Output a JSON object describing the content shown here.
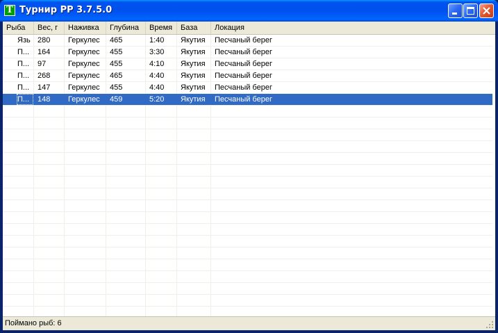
{
  "window": {
    "title": "Турнир РР 3.7.5.0",
    "icon_letter": "T",
    "icon_name": "app-icon",
    "accent_color": "#316ac5"
  },
  "table": {
    "columns": [
      "Рыба",
      "Вес, г",
      "Наживка",
      "Глубина",
      "Время",
      "База",
      "Локация"
    ],
    "rows": [
      [
        "Язь",
        "280",
        "Геркулес",
        "465",
        "1:40",
        "Якутия",
        "Песчаный берег"
      ],
      [
        "П...",
        "164",
        "Геркулес",
        "455",
        "3:30",
        "Якутия",
        "Песчаный берег"
      ],
      [
        "П...",
        "97",
        "Геркулес",
        "455",
        "4:10",
        "Якутия",
        "Песчаный берег"
      ],
      [
        "П...",
        "268",
        "Геркулес",
        "465",
        "4:40",
        "Якутия",
        "Песчаный берег"
      ],
      [
        "П...",
        "147",
        "Геркулес",
        "455",
        "4:40",
        "Якутия",
        "Песчаный берег"
      ],
      [
        "П...",
        "148",
        "Геркулес",
        "459",
        "5:20",
        "Якутия",
        "Песчаный берег"
      ]
    ],
    "selected_row": 5
  },
  "status": {
    "text": "Поймано рыб: 6"
  }
}
